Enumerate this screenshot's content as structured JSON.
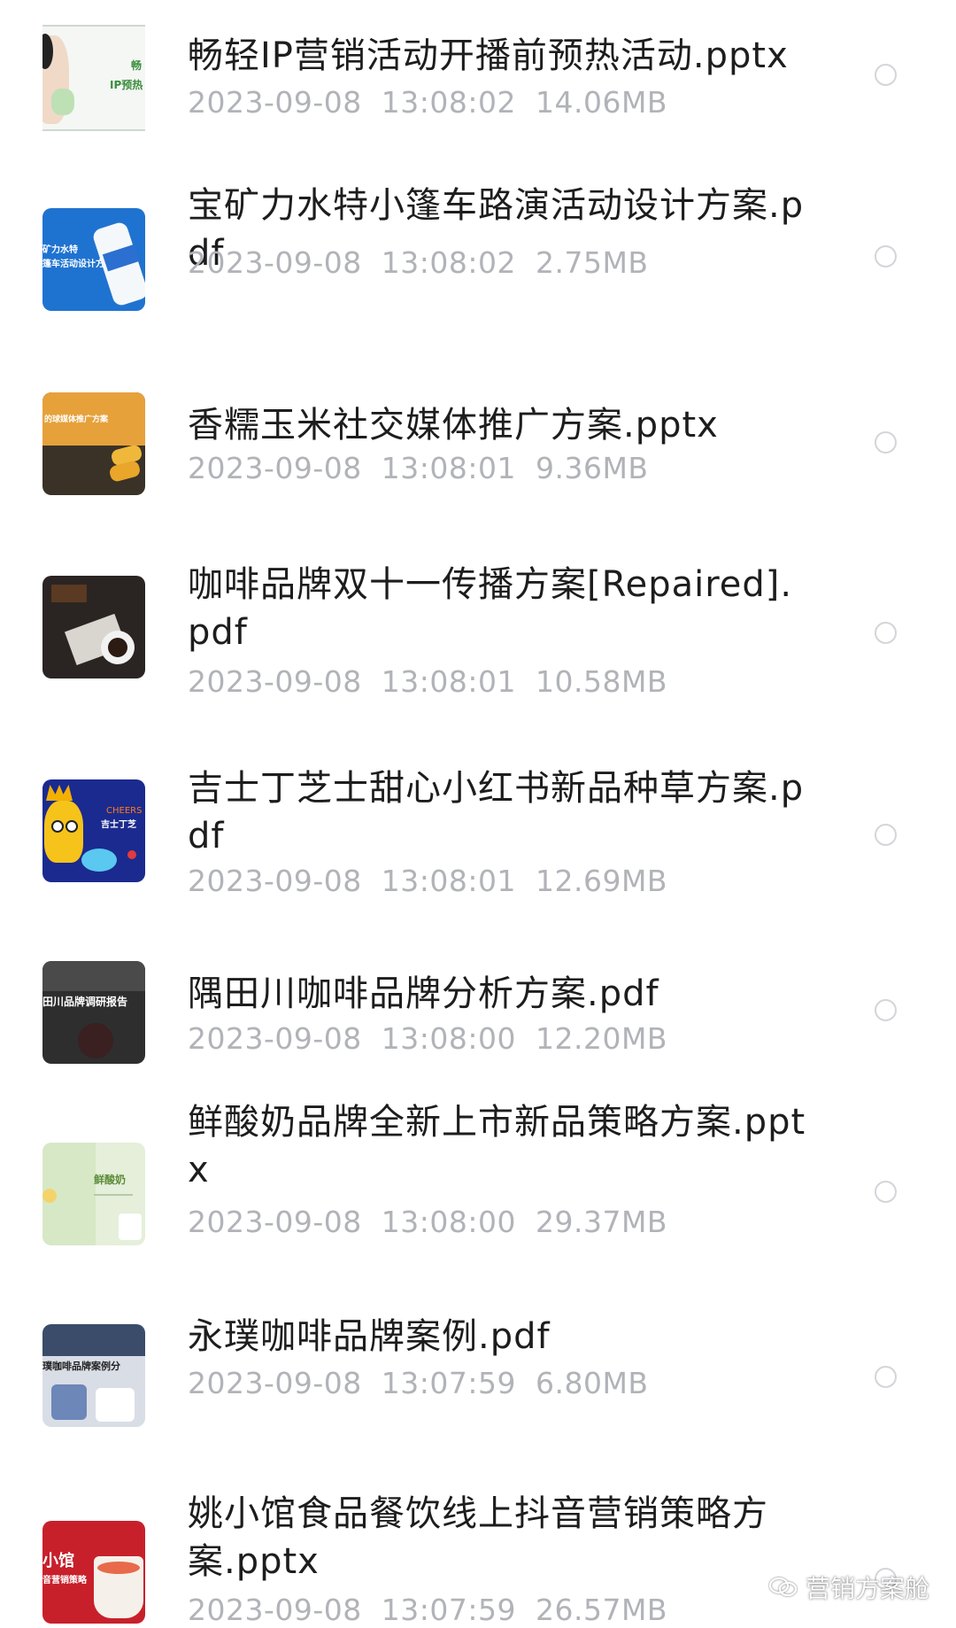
{
  "files": [
    {
      "name": "畅轻IP营销活动开播前预热活动.pptx",
      "date": "2023-09-08",
      "time": "13:08:02",
      "size": "14.06MB",
      "thumb_text": [
        "畅",
        "IP预热"
      ]
    },
    {
      "name": "宝矿力水特小篷车路演活动设计方案.pdf",
      "date": "2023-09-08",
      "time": "13:08:02",
      "size": "2.75MB",
      "thumb_text": [
        "矿力水特",
        "篷车活动设计方案"
      ]
    },
    {
      "name": "香糯玉米社交媒体推广方案.pptx",
      "date": "2023-09-08",
      "time": "13:08:01",
      "size": "9.36MB",
      "thumb_text": [
        "的球媒体推广方案"
      ]
    },
    {
      "name": "咖啡品牌双十一传播方案[Repaired].pdf",
      "date": "2023-09-08",
      "time": "13:08:01",
      "size": "10.58MB",
      "thumb_text": []
    },
    {
      "name": "吉士丁芝士甜心小红书新品种草方案.pdf",
      "date": "2023-09-08",
      "time": "13:08:01",
      "size": "12.69MB",
      "thumb_text": [
        "CHEERS",
        "吉士丁芝"
      ]
    },
    {
      "name": "隅田川咖啡品牌分析方案.pdf",
      "date": "2023-09-08",
      "time": "13:08:00",
      "size": "12.20MB",
      "thumb_text": [
        "田川品牌调研报告"
      ]
    },
    {
      "name": "鲜酸奶品牌全新上市新品策略方案.pptx",
      "date": "2023-09-08",
      "time": "13:08:00",
      "size": "29.37MB",
      "thumb_text": [
        "鲜酸奶"
      ]
    },
    {
      "name": "永璞咖啡品牌案例.pdf",
      "date": "2023-09-08",
      "time": "13:07:59",
      "size": "6.80MB",
      "thumb_text": [
        "璞咖啡品牌案例分"
      ]
    },
    {
      "name": "姚小馆食品餐饮线上抖音营销策略方案.pptx",
      "date": "2023-09-08",
      "time": "13:07:59",
      "size": "26.57MB",
      "thumb_text": [
        "小馆",
        "音营销策略"
      ]
    }
  ],
  "watermark": {
    "text": "营销方案舱",
    "icon": "wechat-channel-icon"
  }
}
